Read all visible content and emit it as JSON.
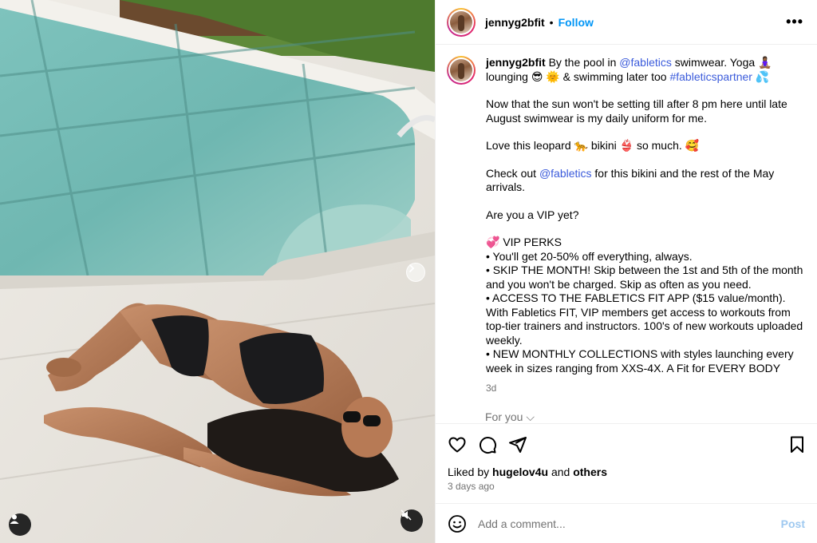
{
  "post": {
    "username": "jennyg2bfit",
    "separator": "•",
    "follow_label": "Follow",
    "more_icon": "more-horizontal-icon",
    "more_label": "•••"
  },
  "caption": {
    "username": "jennyg2bfit",
    "line1_a": "By the pool in",
    "mention1": "@fabletics",
    "line1_b": "swimwear. Yoga 🧘🏾‍♀️ lounging 😎 🌞 & swimming later too",
    "hashtag": "#fabletics​partner",
    "line1_c": "💦",
    "para2": "Now that the sun won't be setting till after 8 pm here until late August swimwear is my daily uniform for me.",
    "para3": "Love this leopard 🐆 bikini 👙 so much. 🥰",
    "para4_a": "Check out",
    "mention2": "@fabletics",
    "para4_b": "for this bikini and the rest of the May arrivals.",
    "para5": "Are you a VIP yet?",
    "perks_title": "💞 VIP PERKS",
    "perk1": "• You'll get 20-50% off everything, always.",
    "perk2": "• SKIP THE MONTH! Skip between the 1st and 5th of the month and you won't be charged. Skip as often as you need.",
    "perk3": "• ACCESS TO THE FABLETICS FIT APP ($15 value/month). With Fabletics FIT, VIP members get access to workouts from top-tier trainers and instructors. 100's of new workouts uploaded weekly.",
    "perk4": "• NEW MONTHLY COLLECTIONS with styles launching every week in sizes ranging from XXS-4X. A Fit for EVERY BODY",
    "age": "3d"
  },
  "for_you": "For you ⌵",
  "likes": {
    "prefix": "Liked by",
    "user": "hugelov4u",
    "joiner": "and",
    "others": "others",
    "time": "3 days ago"
  },
  "comment": {
    "placeholder": "Add a comment...",
    "post_label": "Post"
  },
  "colors": {
    "follow_blue": "#0095f6",
    "link_blue": "#3b5bdb",
    "muted_gray": "#737373",
    "post_disabled": "#9fc9f0"
  }
}
